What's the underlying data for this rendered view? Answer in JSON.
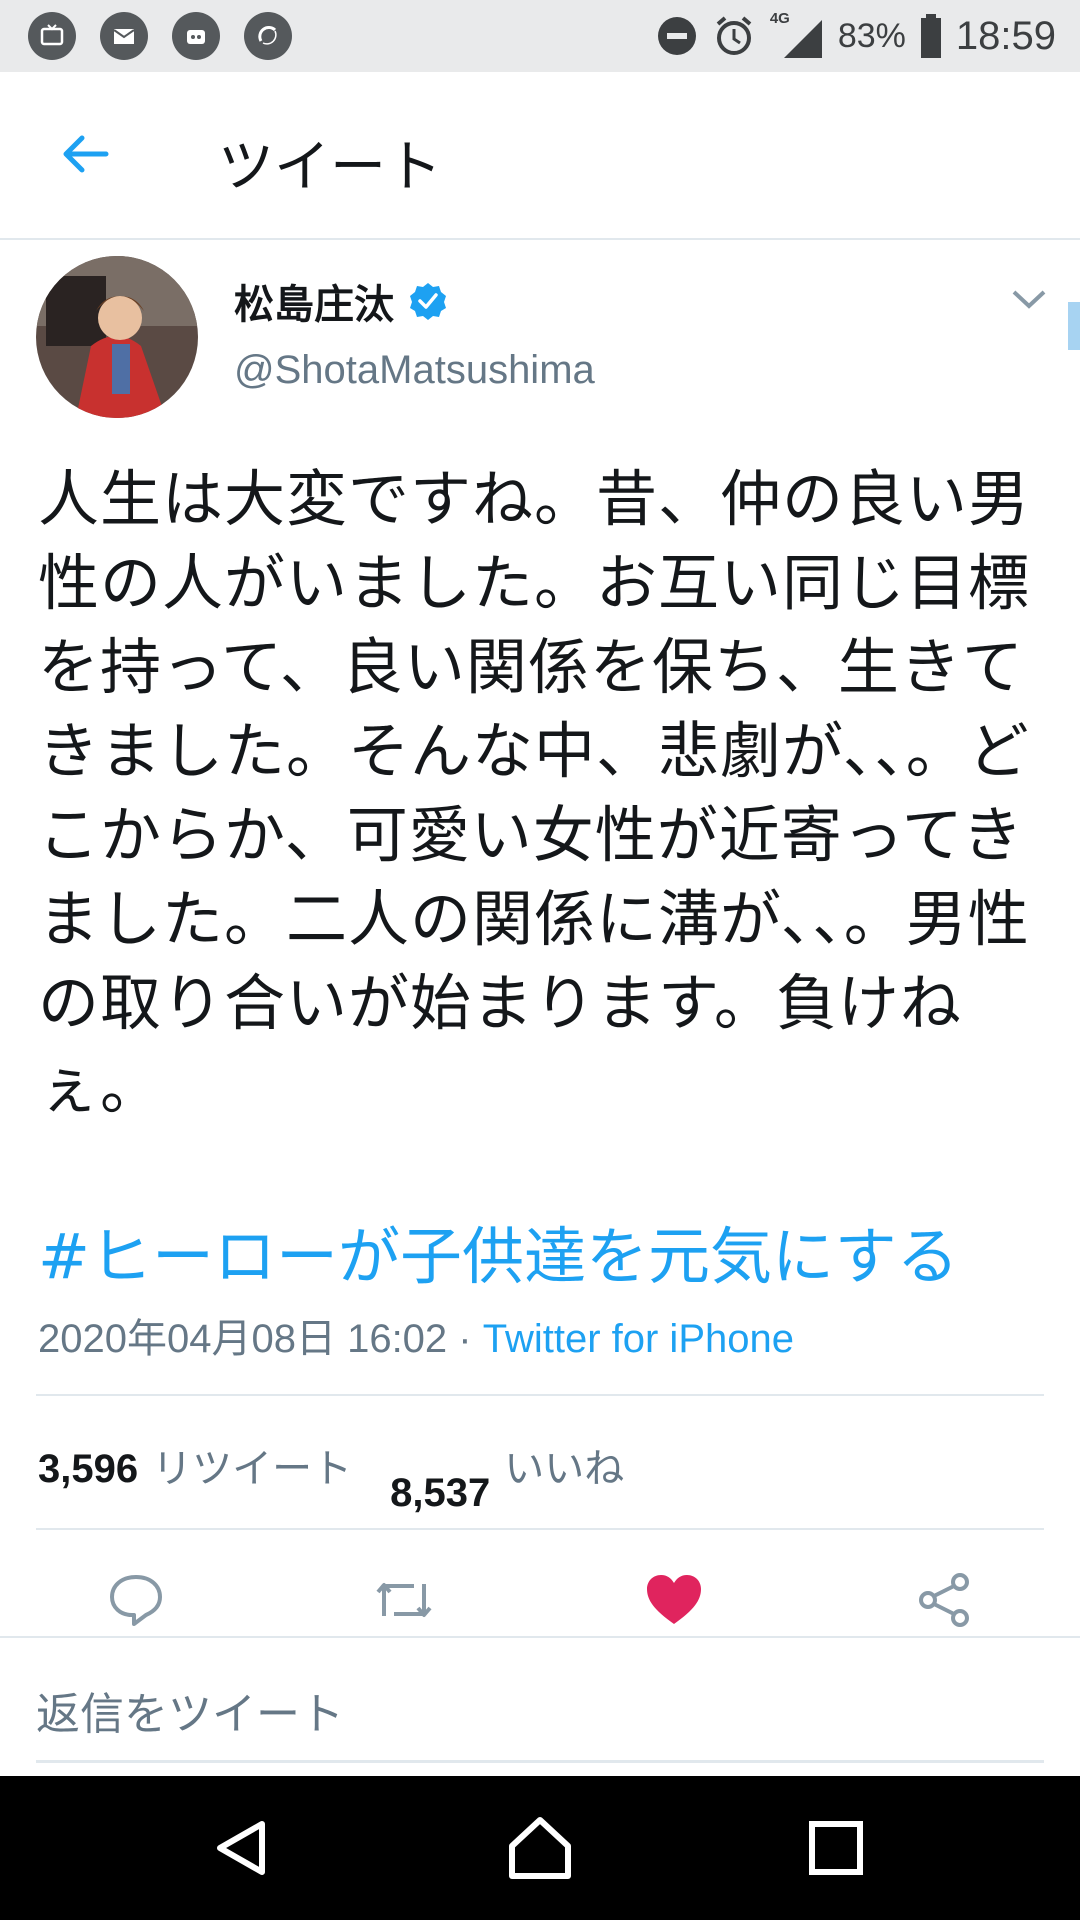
{
  "status_bar": {
    "battery": "83%",
    "time": "18:59",
    "network": "4G",
    "icons_left": [
      "tv-icon",
      "mail-icon",
      "app-icon",
      "sync-icon"
    ],
    "icons_right": [
      "dnd-icon",
      "alarm-icon",
      "signal-icon",
      "battery-icon"
    ]
  },
  "header": {
    "title": "ツイート"
  },
  "tweet": {
    "author_name": "松島庄汰",
    "handle": "@ShotaMatsushima",
    "verified": true,
    "text": "人生は大変ですね。昔、仲の良い男性の人がいました。お互い同じ目標を持って、良い関係を保ち、生きてきました。そんな中、悲劇が、、。どこからか、可愛い女性が近寄ってきました。二人の関係に溝が、、。男性の取り合いが始まります。負けねぇ。",
    "hashtag": "#ヒーローが子供達を元気にする",
    "datetime": "2020年04月08日 16:02",
    "separator": " · ",
    "source": "Twitter for iPhone",
    "retweet_count": "3,596",
    "retweet_label": "リツイート",
    "like_count": "8,537",
    "like_label": "いいね",
    "liked": true
  },
  "reply": {
    "placeholder": "返信をツイート"
  },
  "colors": {
    "accent": "#1da1f2",
    "like": "#e0245e",
    "muted": "#657786"
  }
}
